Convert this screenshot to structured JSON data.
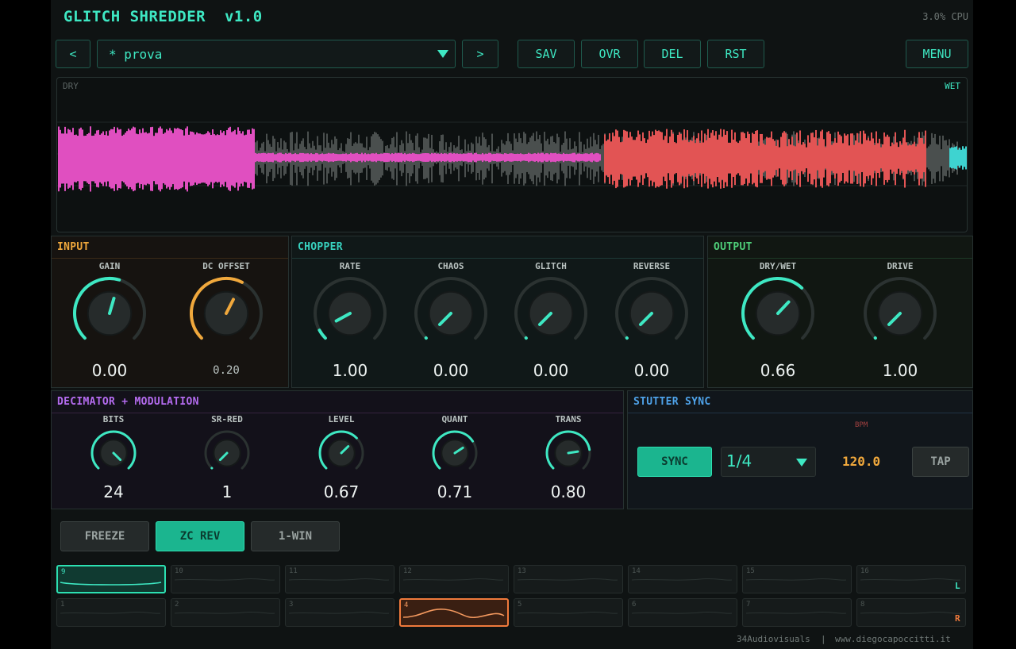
{
  "header": {
    "title": "GLITCH SHREDDER  v1.0",
    "cpu": "3.0% CPU"
  },
  "preset_bar": {
    "prev_label": "<",
    "preset_name": "* prova",
    "next_label": ">",
    "save_label": "SAV",
    "overwrite_label": "OVR",
    "delete_label": "DEL",
    "reset_label": "RST",
    "menu_label": "MENU"
  },
  "waveform": {
    "dry_label": "DRY",
    "wet_label": "WET"
  },
  "input": {
    "title": "INPUT",
    "knobs": [
      {
        "label": "GAIN",
        "value": "0.00",
        "level": 0.56
      },
      {
        "label": "DC OFFSET",
        "value": "0.20",
        "level": 0.6
      }
    ]
  },
  "chopper": {
    "title": "CHOPPER",
    "knobs": [
      {
        "label": "RATE",
        "value": "1.00",
        "level": 0.06
      },
      {
        "label": "CHAOS",
        "value": "0.00",
        "level": 0.0
      },
      {
        "label": "GLITCH",
        "value": "0.00",
        "level": 0.0
      },
      {
        "label": "REVERSE",
        "value": "0.00",
        "level": 0.0
      }
    ]
  },
  "output": {
    "title": "OUTPUT",
    "knobs": [
      {
        "label": "DRY/WET",
        "value": "0.66",
        "level": 0.66
      },
      {
        "label": "DRIVE",
        "value": "1.00",
        "level": 0.0
      }
    ]
  },
  "decimator": {
    "title": "DECIMATOR + MODULATION",
    "knobs": [
      {
        "label": "BITS",
        "value": "24",
        "level": 1.0
      },
      {
        "label": "SR-RED",
        "value": "1",
        "level": 0.0
      },
      {
        "label": "LEVEL",
        "value": "0.67",
        "level": 0.67
      },
      {
        "label": "QUANT",
        "value": "0.71",
        "level": 0.71
      },
      {
        "label": "TRANS",
        "value": "0.80",
        "level": 0.8
      }
    ]
  },
  "stutter": {
    "title": "STUTTER SYNC",
    "sync_label": "SYNC",
    "division": "1/4",
    "bpm_label": "BPM",
    "bpm": "120.0",
    "tap_label": "TAP"
  },
  "modes": {
    "freeze": "FREEZE",
    "zc_rev": "ZC REV",
    "one_win": "1-WIN"
  },
  "slots": {
    "top": [
      "9",
      "10",
      "11",
      "12",
      "13",
      "14",
      "15",
      "16"
    ],
    "bottom": [
      "1",
      "2",
      "3",
      "4",
      "5",
      "6",
      "7",
      "8"
    ],
    "channel_left": "L",
    "channel_right": "R"
  },
  "footer": {
    "credit": "34Audiovisuals",
    "separator": "|",
    "url": "www.diegocapoccitti.it"
  },
  "colors": {
    "accent": "#3ee8c3",
    "input": "#f0a83c",
    "chopper": "#38d3c0",
    "output": "#4fd07a",
    "decimator": "#b56cf0",
    "stutter": "#4fa3ea",
    "wave_pink": "#e04fc0",
    "wave_red": "#e25454"
  }
}
